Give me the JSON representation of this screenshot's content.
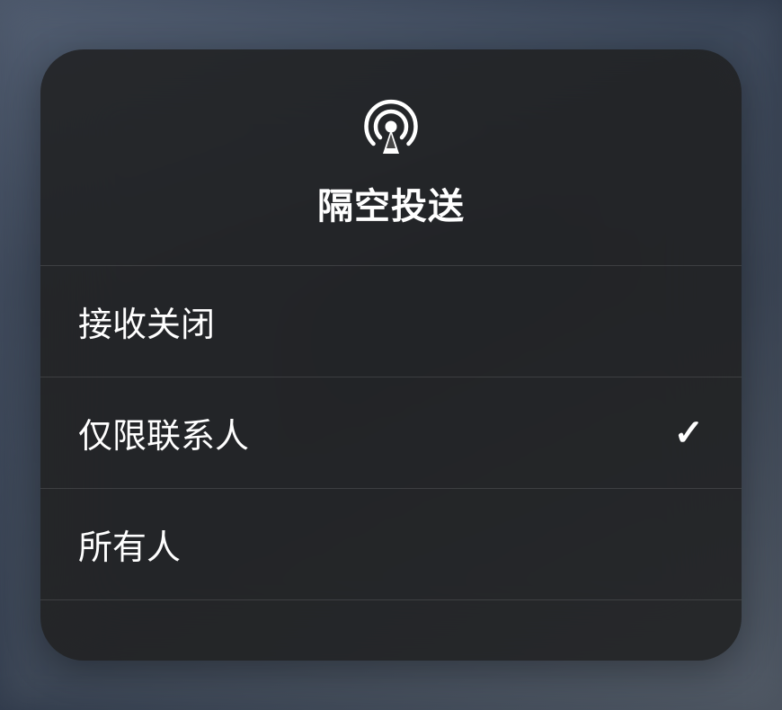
{
  "panel": {
    "title": "隔空投送",
    "icon": "airdrop-icon",
    "options": [
      {
        "label": "接收关闭",
        "selected": false
      },
      {
        "label": "仅限联系人",
        "selected": true
      },
      {
        "label": "所有人",
        "selected": false
      }
    ]
  }
}
